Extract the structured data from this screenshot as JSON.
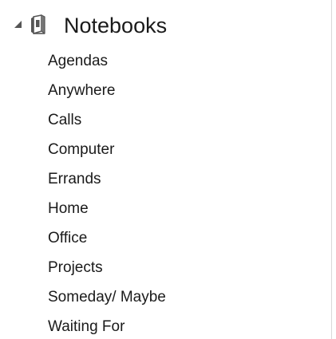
{
  "tree": {
    "expander_icon": "collapse-triangle-icon",
    "root_icon": "notebook-icon",
    "root_label": "Notebooks",
    "items": [
      {
        "label": "Agendas"
      },
      {
        "label": "Anywhere"
      },
      {
        "label": "Calls"
      },
      {
        "label": "Computer"
      },
      {
        "label": "Errands"
      },
      {
        "label": "Home"
      },
      {
        "label": "Office"
      },
      {
        "label": "Projects"
      },
      {
        "label": "Someday/ Maybe"
      },
      {
        "label": "Waiting For"
      }
    ]
  },
  "colors": {
    "text": "#1a1a1a",
    "icon": "#555555",
    "border": "#d9d9d9"
  }
}
